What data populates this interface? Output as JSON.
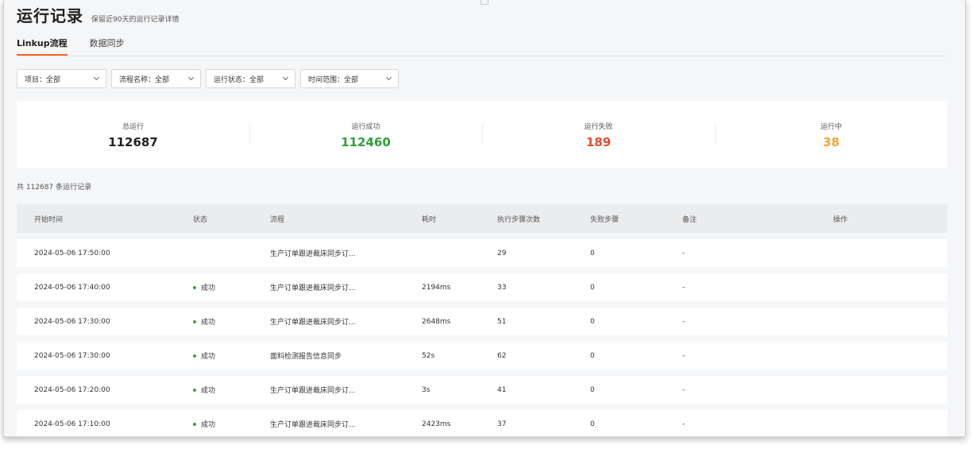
{
  "header": {
    "title": "运行记录",
    "subtitle": "保留近90天的运行记录详情"
  },
  "tabs": [
    {
      "label": "Linkup流程",
      "active": true
    },
    {
      "label": "数据同步",
      "active": false
    }
  ],
  "filters": [
    {
      "label": "项目：全部"
    },
    {
      "label": "流程名称：全部"
    },
    {
      "label": "运行状态：全部"
    },
    {
      "label": "时间范围：全部"
    }
  ],
  "stats": {
    "total": {
      "label": "总运行",
      "value": "112687"
    },
    "success": {
      "label": "运行成功",
      "value": "112460"
    },
    "fail": {
      "label": "运行失败",
      "value": "189"
    },
    "running": {
      "label": "运行中",
      "value": "38"
    }
  },
  "colors": {
    "accent": "#f06622",
    "success": "#2e9e3b",
    "fail": "#e8492a",
    "running": "#f5a532"
  },
  "summary": {
    "count_text": "共 112687 条运行记录"
  },
  "table": {
    "columns": [
      "开始时间",
      "状态",
      "流程",
      "耗时",
      "执行步骤次数",
      "失败步骤",
      "备注",
      "操作"
    ],
    "rows": [
      {
        "start": "2024-05-06 17:50:00",
        "status": "",
        "flow": "生产订单跟进裁床同步订...",
        "duration": "",
        "steps": "29",
        "failed": "0",
        "note": "-"
      },
      {
        "start": "2024-05-06 17:40:00",
        "status": "成功",
        "flow": "生产订单跟进裁床同步订...",
        "duration": "2194ms",
        "steps": "33",
        "failed": "0",
        "note": "-"
      },
      {
        "start": "2024-05-06 17:30:00",
        "status": "成功",
        "flow": "生产订单跟进裁床同步订...",
        "duration": "2648ms",
        "steps": "51",
        "failed": "0",
        "note": "-"
      },
      {
        "start": "2024-05-06 17:30:00",
        "status": "成功",
        "flow": "面料检测报告信息同步",
        "duration": "52s",
        "steps": "62",
        "failed": "0",
        "note": "-"
      },
      {
        "start": "2024-05-06 17:20:00",
        "status": "成功",
        "flow": "生产订单跟进裁床同步订...",
        "duration": "3s",
        "steps": "41",
        "failed": "0",
        "note": "-"
      },
      {
        "start": "2024-05-06 17:10:00",
        "status": "成功",
        "flow": "生产订单跟进裁床同步订...",
        "duration": "2423ms",
        "steps": "37",
        "failed": "0",
        "note": "-"
      }
    ]
  }
}
